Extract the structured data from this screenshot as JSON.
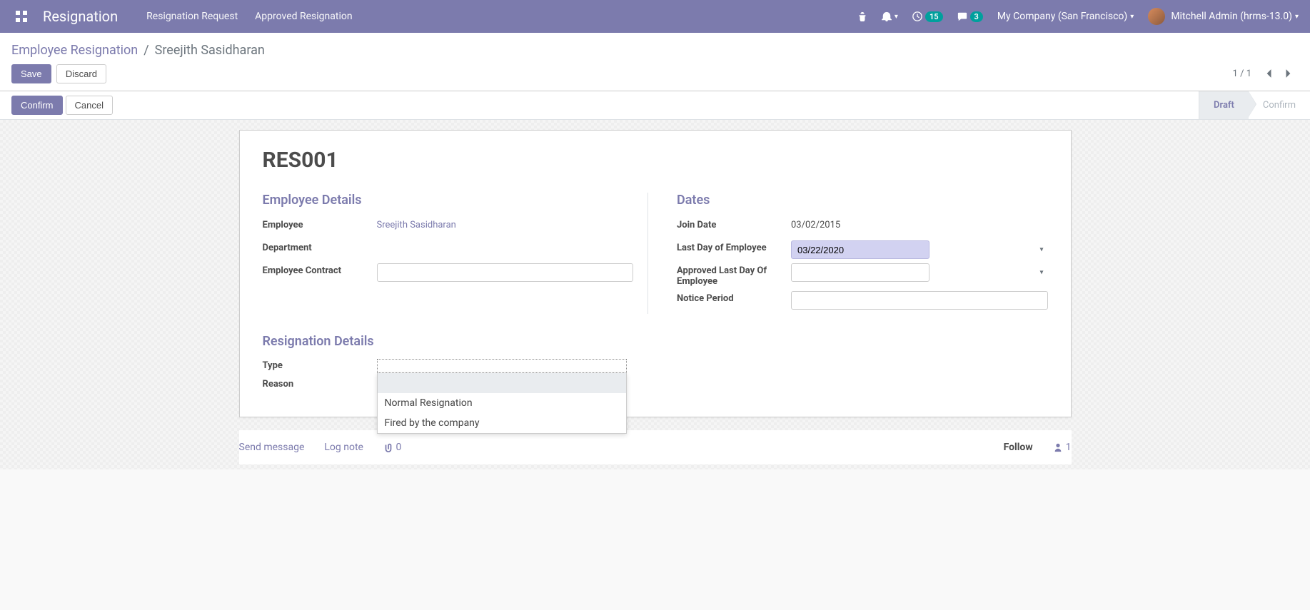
{
  "navbar": {
    "brand": "Resignation",
    "links": [
      "Resignation Request",
      "Approved Resignation"
    ],
    "activity_count": "15",
    "messages_count": "3",
    "company": "My Company (San Francisco)",
    "user": "Mitchell Admin (hrms-13.0)"
  },
  "breadcrumb": {
    "parent": "Employee Resignation",
    "current": "Sreejith Sasidharan"
  },
  "buttons": {
    "save": "Save",
    "discard": "Discard",
    "confirm": "Confirm",
    "cancel": "Cancel"
  },
  "pager": {
    "current": "1",
    "total": "1"
  },
  "statusbar": {
    "draft": "Draft",
    "confirm": "Confirm"
  },
  "record": {
    "name": "RES001",
    "sections": {
      "employee_details": "Employee Details",
      "dates": "Dates",
      "resignation_details": "Resignation Details"
    },
    "labels": {
      "employee": "Employee",
      "department": "Department",
      "employee_contract": "Employee Contract",
      "join_date": "Join Date",
      "last_day": "Last Day of Employee",
      "approved_last_day": "Approved Last Day Of Employee",
      "notice_period": "Notice Period",
      "type": "Type",
      "reason": "Reason"
    },
    "values": {
      "employee": "Sreejith Sasidharan",
      "department": "",
      "employee_contract": "",
      "join_date": "03/02/2015",
      "last_day": "03/22/2020",
      "approved_last_day": "",
      "notice_period": "",
      "type": "",
      "reason": ""
    },
    "type_options": [
      "",
      "Normal Resignation",
      "Fired by the company"
    ]
  },
  "chatter": {
    "send_message": "Send message",
    "log_note": "Log note",
    "attachments": "0",
    "follow": "Follow",
    "followers": "1"
  }
}
